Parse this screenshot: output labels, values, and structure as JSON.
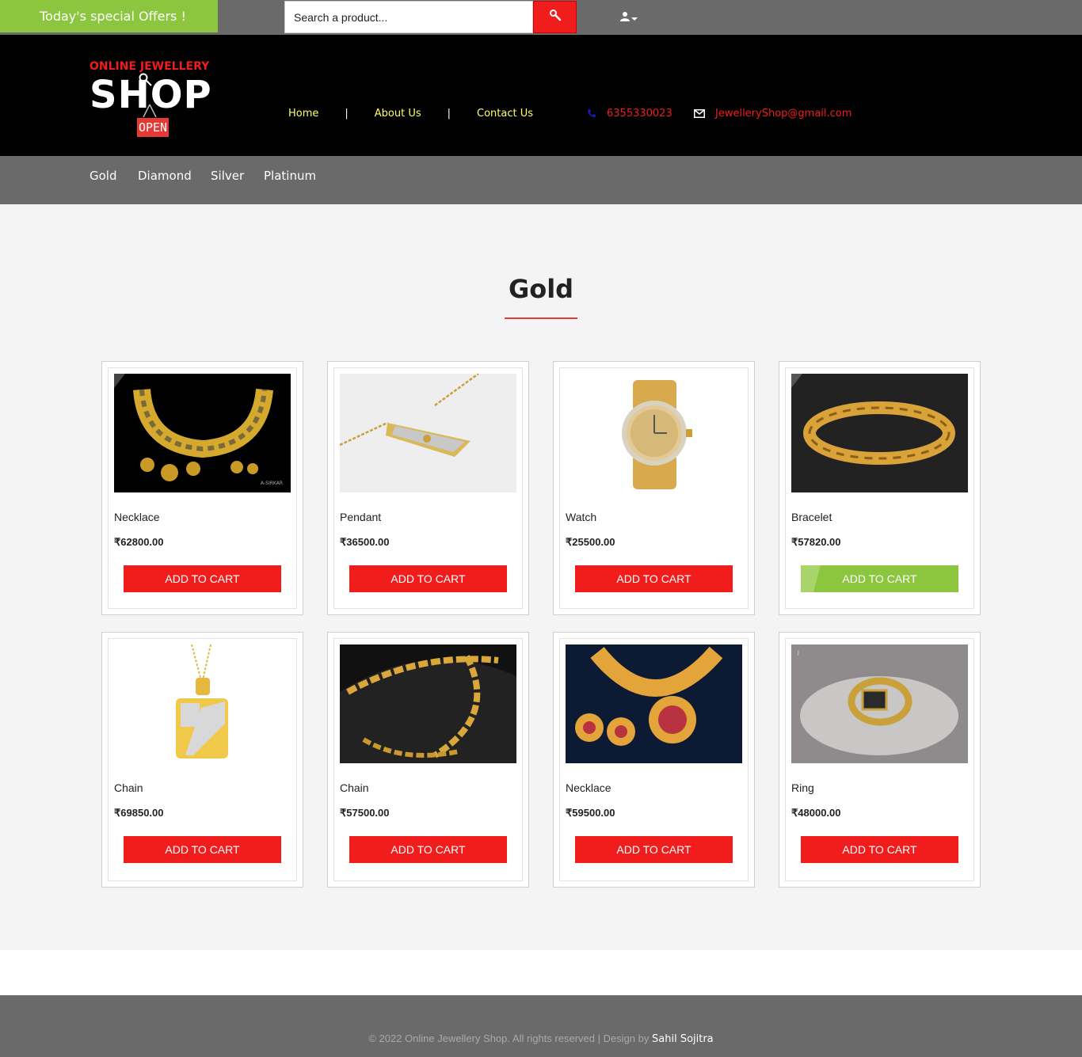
{
  "topbar": {
    "offers_label": "Today's special Offers !",
    "search_placeholder": "Search a product...",
    "search_icon": "search-icon",
    "user_icon": "user-icon"
  },
  "header": {
    "logo": {
      "top": "ONLINE JEWELLERY",
      "main": "SHOP",
      "badge": "OPEN"
    },
    "nav": [
      {
        "label": "Home"
      },
      {
        "label": "About Us"
      },
      {
        "label": "Contact Us"
      }
    ],
    "phone": "6355330023",
    "email": "JewelleryShop@gmail.com"
  },
  "categories": [
    "Gold",
    "Diamond",
    "Silver",
    "Platinum"
  ],
  "section": {
    "title": "Gold"
  },
  "products": [
    {
      "name": "Necklace",
      "price": "₹62800.00",
      "button": "ADD TO CART"
    },
    {
      "name": "Pendant",
      "price": "₹36500.00",
      "button": "ADD TO CART"
    },
    {
      "name": "Watch",
      "price": "₹25500.00",
      "button": "ADD TO CART"
    },
    {
      "name": "Bracelet",
      "price": "₹57820.00",
      "button": "ADD TO CART"
    },
    {
      "name": "Chain",
      "price": "₹69850.00",
      "button": "ADD TO CART"
    },
    {
      "name": "Chain",
      "price": "₹57500.00",
      "button": "ADD TO CART"
    },
    {
      "name": "Necklace",
      "price": "₹59500.00",
      "button": "ADD TO CART"
    },
    {
      "name": "Ring",
      "price": "₹48000.00",
      "button": "ADD TO CART"
    }
  ],
  "footer": {
    "copyright": "© 2022 Online Jewellery Shop. All rights reserved | Design by",
    "author": "Sahil Sojitra"
  },
  "colors": {
    "accent_red": "#f11c1c",
    "accent_green": "#8cc63e",
    "bar_gray": "#6a6a6a",
    "nav_yellow": "#ffff66"
  }
}
